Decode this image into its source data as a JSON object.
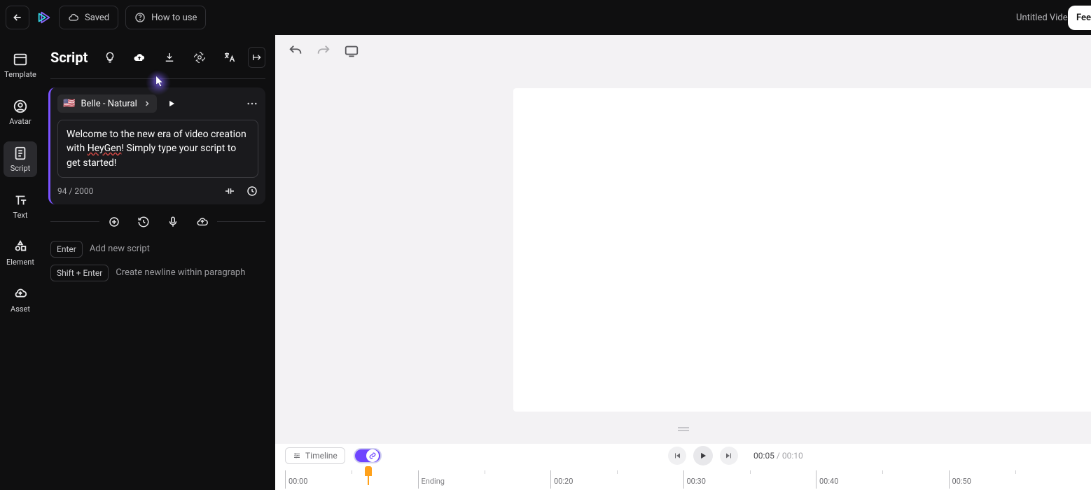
{
  "topbar": {
    "saved_label": "Saved",
    "howto_label": "How to use",
    "title": "Untitled Video",
    "feed_label": "Fee"
  },
  "leftnav": [
    {
      "id": "template",
      "label": "Template"
    },
    {
      "id": "avatar",
      "label": "Avatar"
    },
    {
      "id": "script",
      "label": "Script"
    },
    {
      "id": "text",
      "label": "Text"
    },
    {
      "id": "element",
      "label": "Element"
    },
    {
      "id": "asset",
      "label": "Asset"
    }
  ],
  "script": {
    "title": "Script",
    "voice_name": "Belle - Natural",
    "voice_flag": "🇺🇸",
    "script_text_pre": "Welcome to the new era of video creation with ",
    "script_text_mid": "HeyGen",
    "script_text_post": "! Simply type your script to get started!",
    "count": "94 / 2000",
    "hint1_key": "Enter",
    "hint1_text": "Add new script",
    "hint2_key": "Shift + Enter",
    "hint2_text": "Create newline within paragraph"
  },
  "timeline": {
    "button_label": "Timeline",
    "current": "00:05",
    "total": "00:10",
    "ticks": [
      "00:00",
      "Ending",
      "00:20",
      "00:30",
      "00:40",
      "00:50"
    ]
  }
}
